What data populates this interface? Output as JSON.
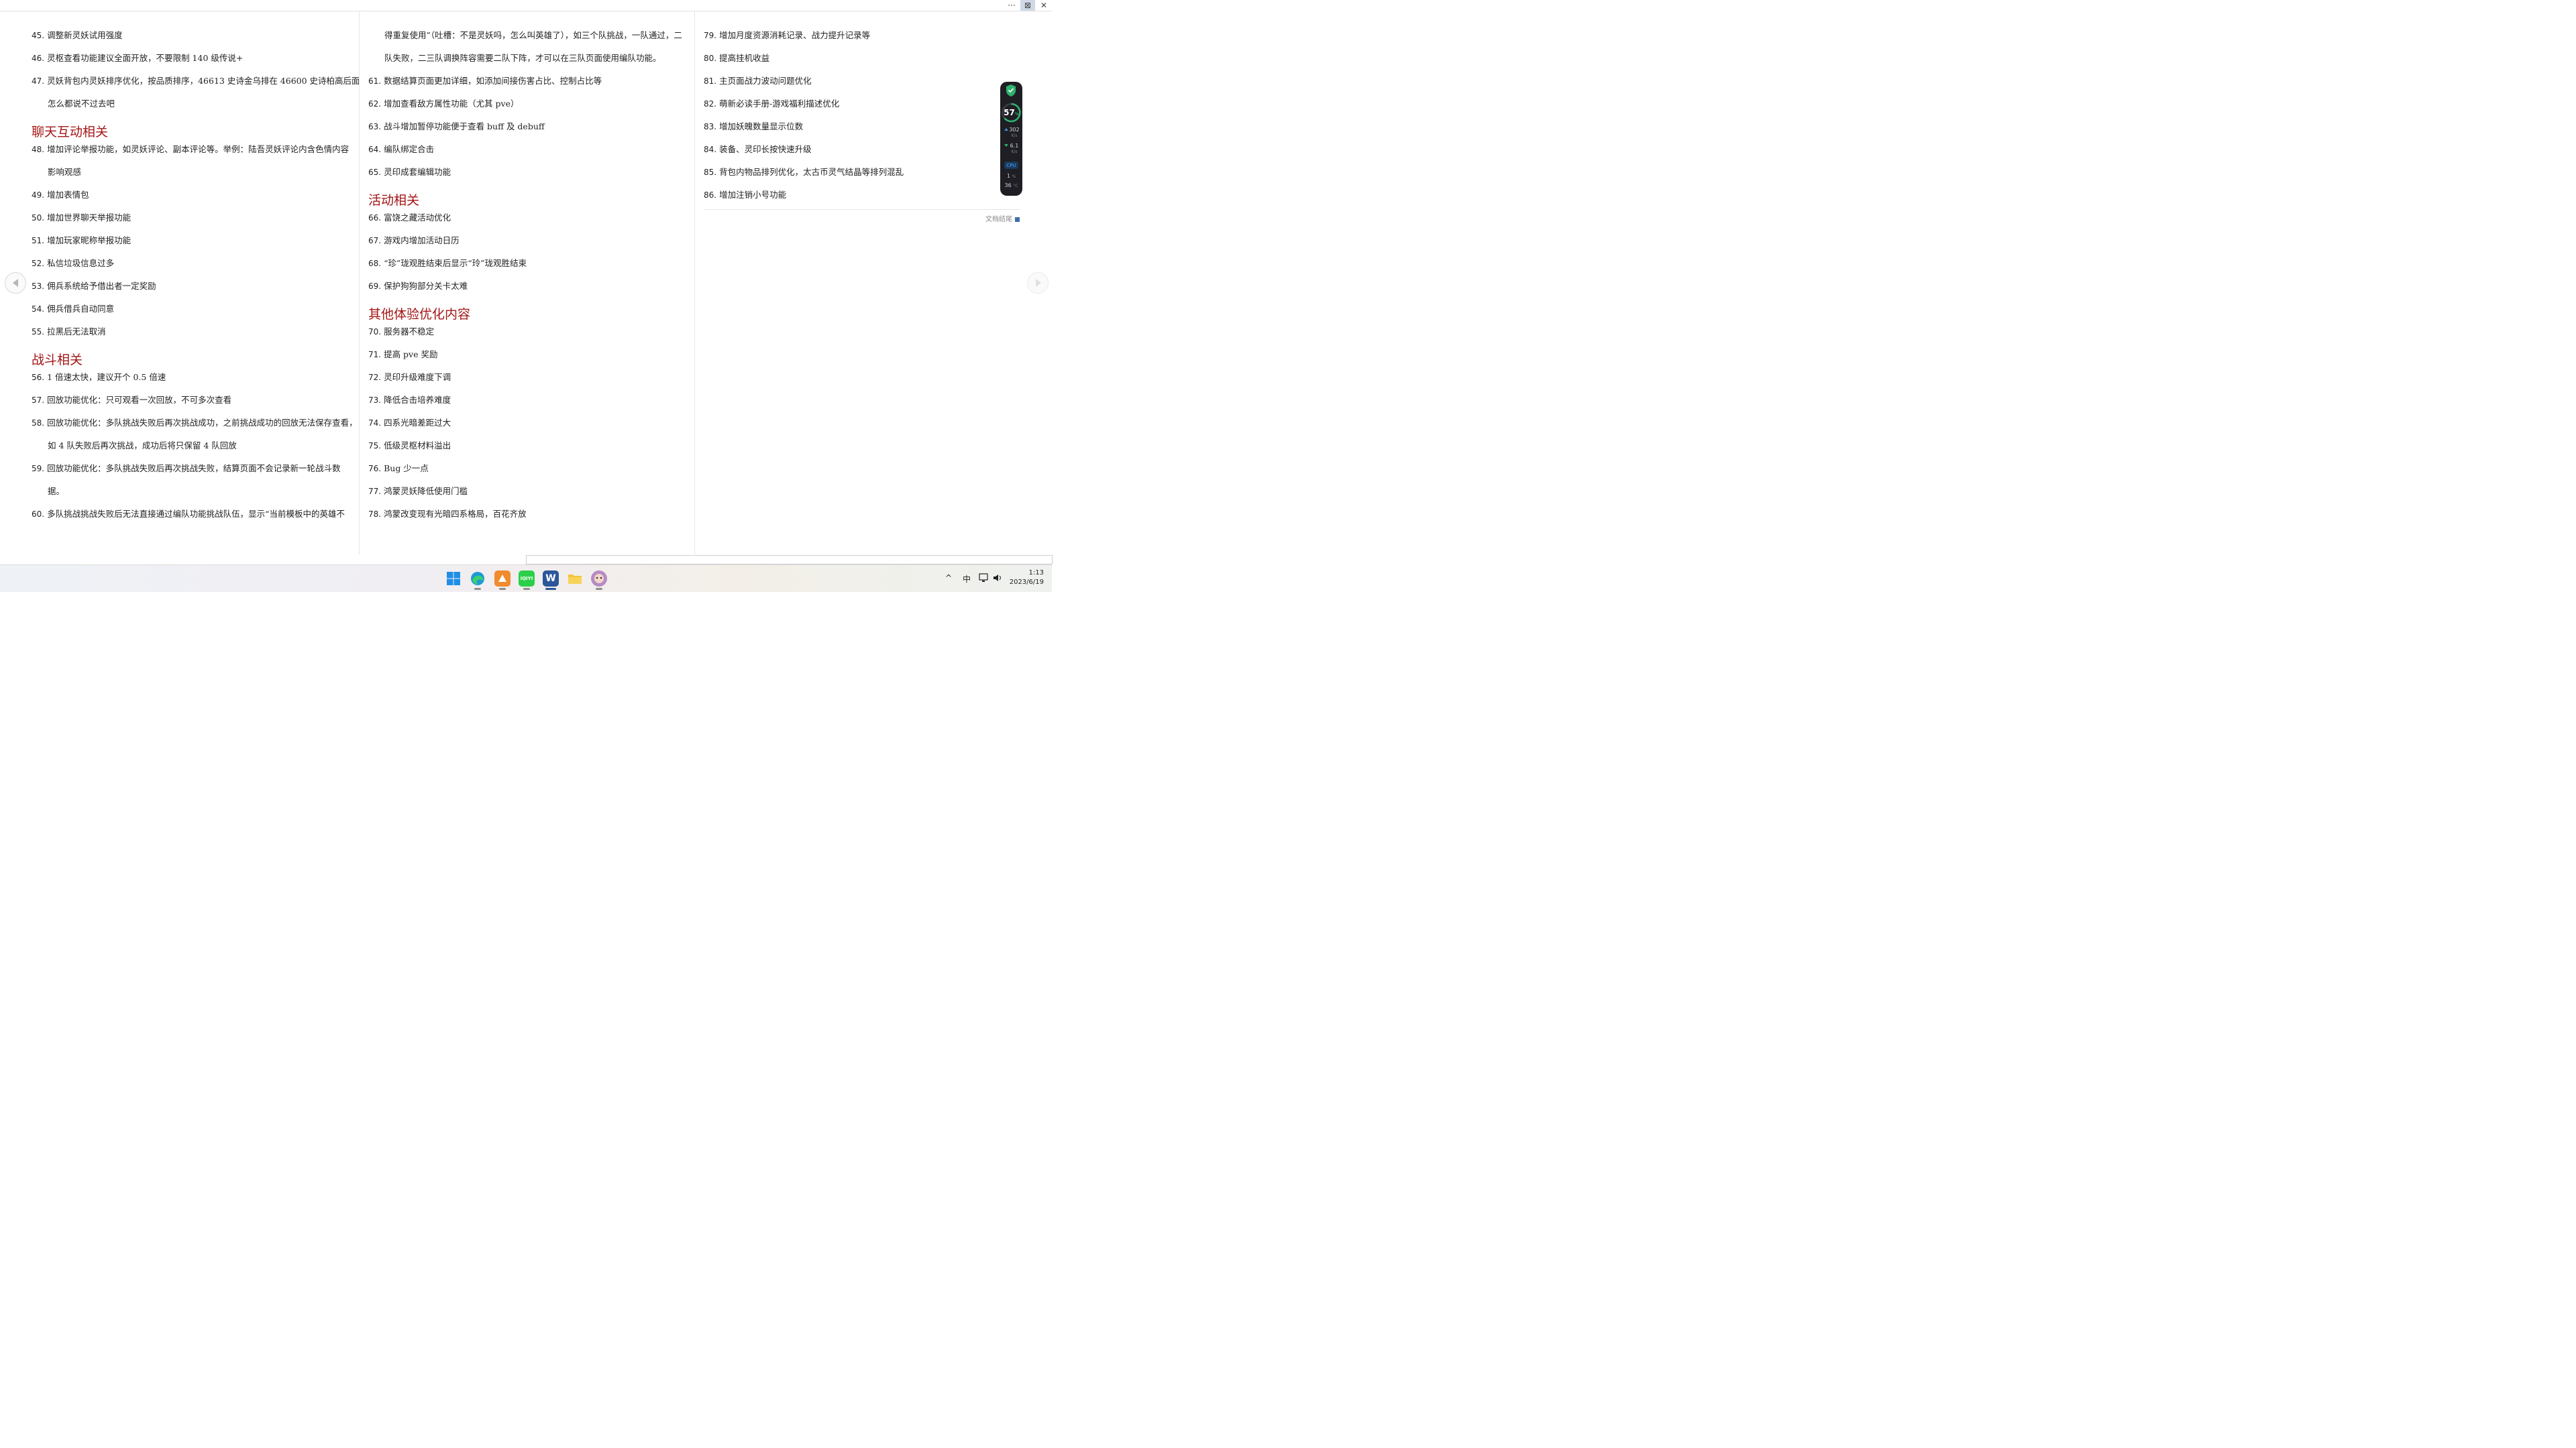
{
  "window": {
    "more_label": "···",
    "restore_label": "⊠",
    "close_label": "✕"
  },
  "columns": [
    {
      "blocks": [
        {
          "type": "item",
          "num": "45.",
          "text": "调整新灵妖试用强度"
        },
        {
          "type": "item",
          "num": "46.",
          "text": "灵枢查看功能建议全面开放，不要限制 140 级传说+"
        },
        {
          "type": "item",
          "num": "47.",
          "text": "灵妖背包内灵妖排序优化，按品质排序，46613 史诗金乌排在 46600 史诗柏高后面"
        },
        {
          "type": "cont",
          "text": "怎么都说不过去吧"
        },
        {
          "type": "heading",
          "text": "聊天互动相关"
        },
        {
          "type": "item",
          "num": "48.",
          "text": "增加评论举报功能，如灵妖评论、副本评论等。举例：陆吾灵妖评论内含色情内容"
        },
        {
          "type": "cont",
          "text": "影响观感"
        },
        {
          "type": "item",
          "num": "49.",
          "text": "增加表情包"
        },
        {
          "type": "item",
          "num": "50.",
          "text": "增加世界聊天举报功能"
        },
        {
          "type": "item",
          "num": "51.",
          "text": "增加玩家昵称举报功能"
        },
        {
          "type": "item",
          "num": "52.",
          "text": "私信垃圾信息过多"
        },
        {
          "type": "item",
          "num": "53.",
          "text": "佣兵系统给予借出者一定奖励"
        },
        {
          "type": "item",
          "num": "54.",
          "text": "佣兵借兵自动同意"
        },
        {
          "type": "item",
          "num": "55.",
          "text": "拉黑后无法取消"
        },
        {
          "type": "heading",
          "text": "战斗相关"
        },
        {
          "type": "item",
          "num": "56.",
          "text": "1 倍速太快，建议开个 0.5 倍速"
        },
        {
          "type": "item",
          "num": "57.",
          "text": "回放功能优化：只可观看一次回放，不可多次查看"
        },
        {
          "type": "item",
          "num": "58.",
          "text": "回放功能优化：多队挑战失败后再次挑战成功，之前挑战成功的回放无法保存查看，"
        },
        {
          "type": "cont",
          "text": "如 4 队失败后再次挑战，成功后将只保留 4 队回放"
        },
        {
          "type": "item",
          "num": "59.",
          "text": "回放功能优化：多队挑战失败后再次挑战失败，结算页面不会记录新一轮战斗数"
        },
        {
          "type": "cont",
          "text": "据。"
        },
        {
          "type": "item",
          "num": "60.",
          "text": "多队挑战挑战失败后无法直接通过编队功能挑战队伍，显示“当前模板中的英雄不"
        }
      ]
    },
    {
      "blocks": [
        {
          "type": "cont",
          "text": "得重复使用”（吐槽：不是灵妖吗，怎么叫英雄了），如三个队挑战，一队通过，二"
        },
        {
          "type": "cont",
          "text": "队失败，二三队调换阵容需要二队下阵，才可以在三队页面使用编队功能。"
        },
        {
          "type": "item",
          "num": "61.",
          "text": "数据结算页面更加详细，如添加间接伤害占比、控制占比等"
        },
        {
          "type": "item",
          "num": "62.",
          "text": "增加查看敌方属性功能（尤其 pve）"
        },
        {
          "type": "item",
          "num": "63.",
          "text": "战斗增加暂停功能便于查看 buff 及 debuff"
        },
        {
          "type": "item",
          "num": "64.",
          "text": "编队绑定合击"
        },
        {
          "type": "item",
          "num": "65.",
          "text": "灵印成套编辑功能"
        },
        {
          "type": "heading",
          "text": "活动相关"
        },
        {
          "type": "item",
          "num": "66.",
          "text": "富饶之藏活动优化"
        },
        {
          "type": "item",
          "num": "67.",
          "text": "游戏内增加活动日历"
        },
        {
          "type": "item",
          "num": "68.",
          "text": "“珍”珑观胜结束后显示“玲”珑观胜结束"
        },
        {
          "type": "item",
          "num": "69.",
          "text": "保护狗狗部分关卡太难"
        },
        {
          "type": "heading",
          "text": "其他体验优化内容"
        },
        {
          "type": "item",
          "num": "70.",
          "text": "服务器不稳定"
        },
        {
          "type": "item",
          "num": "71.",
          "text": "提高 pve 奖励"
        },
        {
          "type": "item",
          "num": "72.",
          "text": "灵印升级难度下调"
        },
        {
          "type": "item",
          "num": "73.",
          "text": "降低合击培养难度"
        },
        {
          "type": "item",
          "num": "74.",
          "text": "四系光暗差距过大"
        },
        {
          "type": "item",
          "num": "75.",
          "text": "低级灵枢材料溢出"
        },
        {
          "type": "item",
          "num": "76.",
          "text": "Bug 少一点"
        },
        {
          "type": "item",
          "num": "77.",
          "text": "鸿蒙灵妖降低使用门槛"
        },
        {
          "type": "item",
          "num": "78.",
          "text": "鸿蒙改变现有光暗四系格局，百花齐放"
        }
      ]
    },
    {
      "blocks": [
        {
          "type": "item",
          "num": "79.",
          "text": "增加月度资源消耗记录、战力提升记录等"
        },
        {
          "type": "item",
          "num": "80.",
          "text": "提高挂机收益"
        },
        {
          "type": "item",
          "num": "81.",
          "text": "主页面战力波动问题优化"
        },
        {
          "type": "item",
          "num": "82.",
          "text": "萌新必读手册-游戏福利描述优化"
        },
        {
          "type": "item",
          "num": "83.",
          "text": "增加妖魄数量显示位数"
        },
        {
          "type": "item",
          "num": "84.",
          "text": "装备、灵印长按快速升级"
        },
        {
          "type": "item",
          "num": "85.",
          "text": "背包内物品排列优化，太古币灵气结晶等排列混乱"
        },
        {
          "type": "item",
          "num": "86.",
          "text": "增加注销小号功能"
        }
      ]
    }
  ],
  "end_marker": "文档结尾",
  "net_widget": {
    "percent": "57",
    "percent_unit": "%",
    "up_speed": "302",
    "up_unit": "K/s",
    "down_speed": "6.1",
    "down_unit": "K/s",
    "cpu_label": "CPU",
    "cpu_value": "1",
    "cpu_unit": "%",
    "temp_value": "36",
    "temp_unit": "°C"
  },
  "taskbar": {
    "apps": [
      "windows-start",
      "edge",
      "app-orange",
      "iqiyi",
      "word",
      "file-explorer",
      "game-app"
    ],
    "iqiyi_label": "iQIYI",
    "word_label": "W",
    "tray": {
      "chevron": "^",
      "ime": "中",
      "time": "1:13",
      "date": "2023/6/19"
    }
  }
}
